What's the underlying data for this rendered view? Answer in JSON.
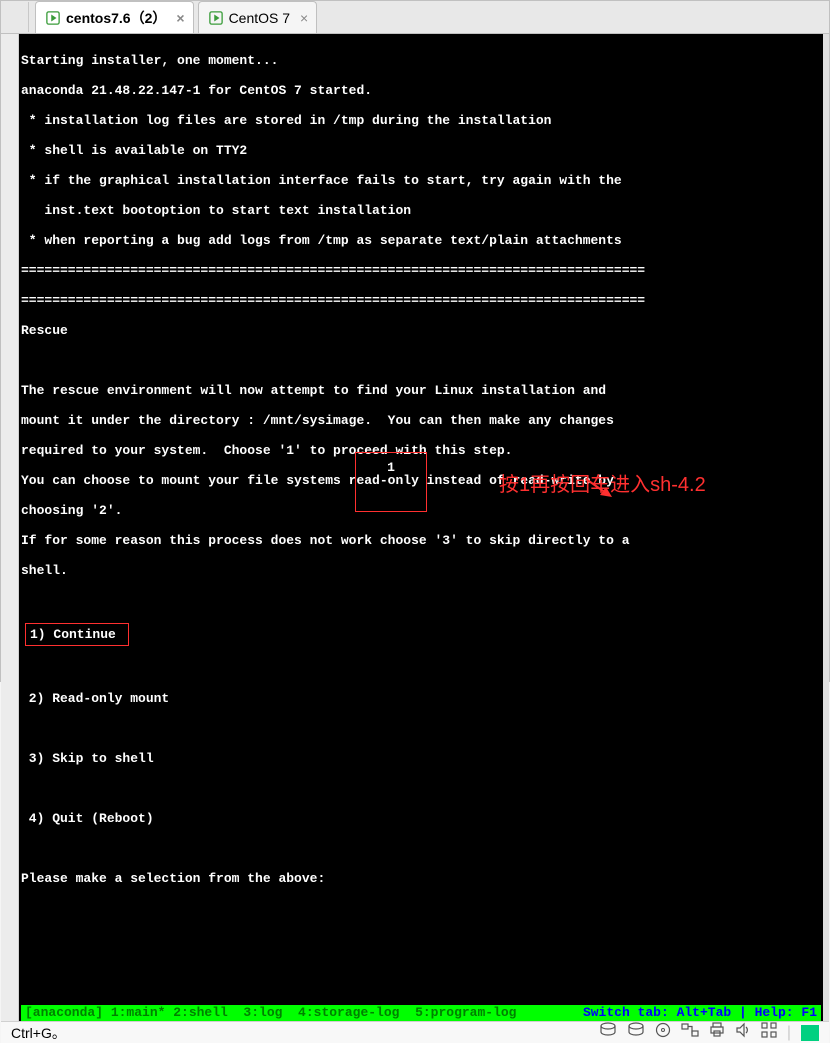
{
  "tabs": [
    {
      "label": "centos7.6（2）",
      "active": true
    },
    {
      "label": "CentOS 7",
      "active": false
    }
  ],
  "terminal": {
    "l1": "Starting installer, one moment...",
    "l2": "anaconda 21.48.22.147-1 for CentOS 7 started.",
    "l3": " * installation log files are stored in /tmp during the installation",
    "l4": " * shell is available on TTY2",
    "l5": " * if the graphical installation interface fails to start, try again with the",
    "l6": "   inst.text bootoption to start text installation",
    "l7": " * when reporting a bug add logs from /tmp as separate text/plain attachments",
    "divider": "================================================================================",
    "rescue_title": "Rescue",
    "r1": "The rescue environment will now attempt to find your Linux installation and",
    "r2": "mount it under the directory : /mnt/sysimage.  You can then make any changes",
    "r3": "required to your system.  Choose '1' to proceed with this step.",
    "r4": "You can choose to mount your file systems read-only instead of read-write by",
    "r5": "choosing '2'.",
    "r6": "If for some reason this process does not work choose '3' to skip directly to a",
    "r7": "shell.",
    "opt1": "1) Continue",
    "opt2": " 2) Read-only mount",
    "opt3": " 3) Skip to shell",
    "opt4": " 4) Quit (Reboot)",
    "prompt": "Please make a selection from the above",
    "input": "1",
    "status_left": "[anaconda] 1:main* 2:shell  3:log  4:storage-log  5:program-log",
    "status_right": "Switch tab: Alt+Tab | Help: F1"
  },
  "annotation": {
    "text": "按1再按回车进入sh-4.2"
  },
  "bottom": {
    "hint": "Ctrl+G。"
  }
}
